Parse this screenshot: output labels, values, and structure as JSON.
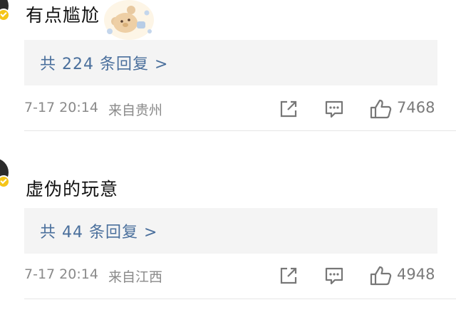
{
  "comments": [
    {
      "text": "有点尴尬",
      "replies_label": "共 224 条回复 >",
      "time": "7-17 20:14",
      "location": "来自贵州",
      "likes": "7468"
    },
    {
      "text": "虚伪的玩意",
      "replies_label": "共 44 条回复 >",
      "time": "7-17 20:14",
      "location": "来自江西",
      "likes": "4948"
    }
  ],
  "colors": {
    "link": "#4a6f9c",
    "meta": "#8a8a8a",
    "reply_bg": "#f4f4f4",
    "badge": "#f5c518"
  },
  "icons": {
    "share": "share-icon",
    "comment": "comment-icon",
    "like": "thumbs-up-icon",
    "verified": "verified-badge-icon"
  }
}
